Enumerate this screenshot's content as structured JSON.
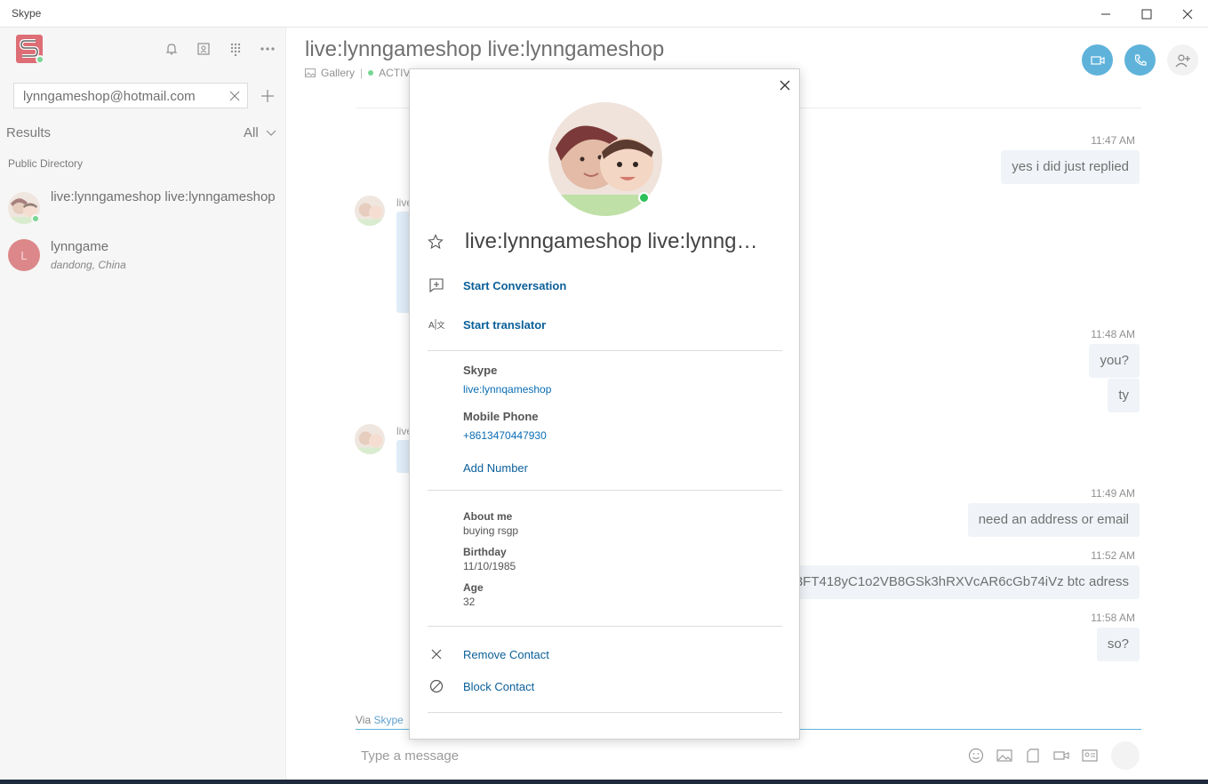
{
  "window": {
    "title": "Skype"
  },
  "sidebar": {
    "search_value": "lynngameshop@hotmail.com",
    "results_label": "Results",
    "filter_label": "All",
    "section_label": "Public Directory",
    "results": [
      {
        "name": "live:lynngameshop live:lynngameshop",
        "subtitle": ""
      },
      {
        "name": "lynngame",
        "subtitle": "dandong, China",
        "initial": "L"
      }
    ]
  },
  "conversation": {
    "title": "live:lynngameshop live:lynngameshop",
    "gallery_label": "Gallery",
    "status_label": "ACTIV",
    "sender_stub": "live",
    "messages": [
      {
        "time": "11:47 AM",
        "texts": [
          "yes i did just replied"
        ]
      },
      {
        "time": "11:48 AM",
        "texts": [
          "you?",
          "ty"
        ]
      },
      {
        "time": "11:49 AM",
        "texts": [
          "need an address or email"
        ]
      },
      {
        "time": "11:52 AM",
        "texts": [
          "3FT418yC1o2VB8GSk3hRXVcAR6cGb74iVz btc adress"
        ]
      },
      {
        "time": "11:58 AM",
        "texts": [
          "so?"
        ]
      }
    ],
    "via_prefix": "Via",
    "via_link": "Skype",
    "compose_placeholder": "Type a message"
  },
  "profile": {
    "name": "live:lynngameshop live:lynnga...",
    "start_conversation": "Start Conversation",
    "start_translator": "Start translator",
    "skype_label": "Skype",
    "skype_id": "live:lynnqameshop",
    "mobile_label": "Mobile Phone",
    "mobile_value": "+8613470447930",
    "add_number": "Add Number",
    "about_label": "About me",
    "about_value": "buying rsgp",
    "birthday_label": "Birthday",
    "birthday_value": "11/10/1985",
    "age_label": "Age",
    "age_value": "32",
    "remove_contact": "Remove Contact",
    "block_contact": "Block Contact"
  },
  "colors": {
    "accent": "#0a8bc6",
    "link": "#0a6db5",
    "online": "#2ec05a",
    "bubble_out": "#e8eef5"
  }
}
